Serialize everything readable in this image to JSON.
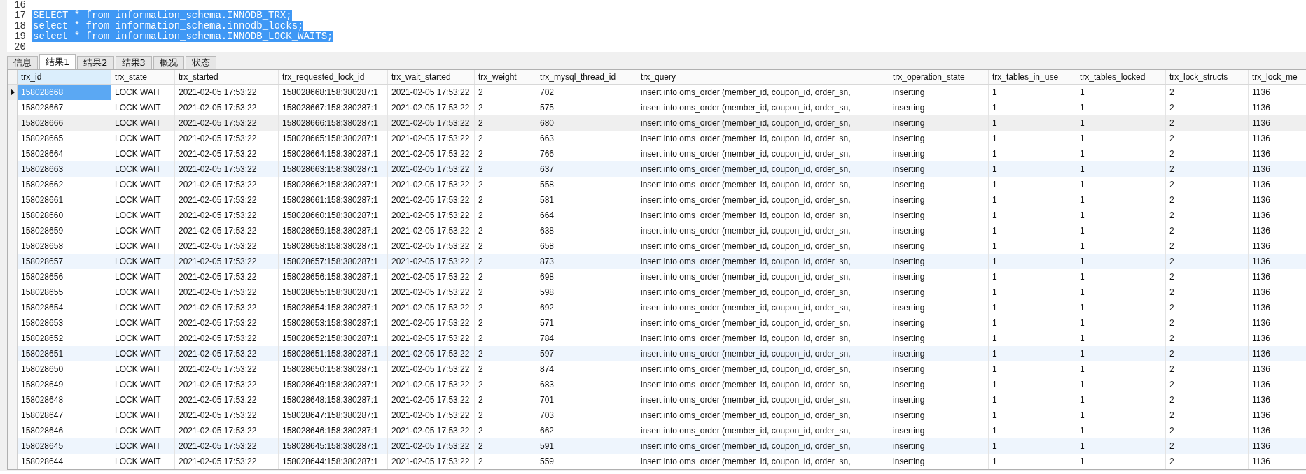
{
  "editor": {
    "lines": [
      {
        "number": "16"
      },
      {
        "number": "17",
        "code": "SELECT * from information_schema.INNODB_TRX;",
        "selected": true
      },
      {
        "number": "18",
        "code": "select * from information_schema.innodb_locks;",
        "selected": true
      },
      {
        "number": "19",
        "code": "select * from information_schema.INNODB_LOCK_WAITS;",
        "selected": true
      },
      {
        "number": "20"
      }
    ]
  },
  "tabs": [
    {
      "label": "信息",
      "selected": false
    },
    {
      "label": "结果1",
      "selected": true
    },
    {
      "label": "结果2",
      "selected": false
    },
    {
      "label": "结果3",
      "selected": false
    },
    {
      "label": "概况",
      "selected": false
    },
    {
      "label": "状态",
      "selected": false
    }
  ],
  "table": {
    "columns": [
      {
        "label": "trx_id",
        "selected": true
      },
      {
        "label": "trx_state",
        "selected": false
      },
      {
        "label": "trx_started",
        "selected": false
      },
      {
        "label": "trx_requested_lock_id",
        "selected": false
      },
      {
        "label": "trx_wait_started",
        "selected": false
      },
      {
        "label": "trx_weight",
        "selected": false
      },
      {
        "label": "trx_mysql_thread_id",
        "selected": false
      },
      {
        "label": "trx_query",
        "selected": false
      },
      {
        "label": "trx_operation_state",
        "selected": false
      },
      {
        "label": "trx_tables_in_use",
        "selected": false
      },
      {
        "label": "trx_tables_locked",
        "selected": false
      },
      {
        "label": "trx_lock_structs",
        "selected": false
      },
      {
        "label": "trx_lock_me",
        "selected": false
      }
    ],
    "rows": [
      {
        "selected": true,
        "kind": "plain",
        "cells": [
          "158028668",
          "LOCK WAIT",
          "2021-02-05 17:53:22",
          "158028668:158:380287:1",
          "2021-02-05 17:53:22",
          "2",
          "702",
          "insert into oms_order (member_id, coupon_id, order_sn,",
          "inserting",
          "1",
          "1",
          "2",
          "1136"
        ]
      },
      {
        "selected": false,
        "kind": "plain",
        "cells": [
          "158028667",
          "LOCK WAIT",
          "2021-02-05 17:53:22",
          "158028667:158:380287:1",
          "2021-02-05 17:53:22",
          "2",
          "575",
          "insert into oms_order (member_id, coupon_id, order_sn,",
          "inserting",
          "1",
          "1",
          "2",
          "1136"
        ]
      },
      {
        "selected": false,
        "kind": "hover",
        "cells": [
          "158028666",
          "LOCK WAIT",
          "2021-02-05 17:53:22",
          "158028666:158:380287:1",
          "2021-02-05 17:53:22",
          "2",
          "680",
          "insert into oms_order (member_id, coupon_id, order_sn,",
          "inserting",
          "1",
          "1",
          "2",
          "1136"
        ]
      },
      {
        "selected": false,
        "kind": "plain",
        "cells": [
          "158028665",
          "LOCK WAIT",
          "2021-02-05 17:53:22",
          "158028665:158:380287:1",
          "2021-02-05 17:53:22",
          "2",
          "663",
          "insert into oms_order (member_id, coupon_id, order_sn,",
          "inserting",
          "1",
          "1",
          "2",
          "1136"
        ]
      },
      {
        "selected": false,
        "kind": "plain",
        "cells": [
          "158028664",
          "LOCK WAIT",
          "2021-02-05 17:53:22",
          "158028664:158:380287:1",
          "2021-02-05 17:53:22",
          "2",
          "766",
          "insert into oms_order (member_id, coupon_id, order_sn,",
          "inserting",
          "1",
          "1",
          "2",
          "1136"
        ]
      },
      {
        "selected": false,
        "kind": "alt",
        "cells": [
          "158028663",
          "LOCK WAIT",
          "2021-02-05 17:53:22",
          "158028663:158:380287:1",
          "2021-02-05 17:53:22",
          "2",
          "637",
          "insert into oms_order (member_id, coupon_id, order_sn,",
          "inserting",
          "1",
          "1",
          "2",
          "1136"
        ]
      },
      {
        "selected": false,
        "kind": "plain",
        "cells": [
          "158028662",
          "LOCK WAIT",
          "2021-02-05 17:53:22",
          "158028662:158:380287:1",
          "2021-02-05 17:53:22",
          "2",
          "558",
          "insert into oms_order (member_id, coupon_id, order_sn,",
          "inserting",
          "1",
          "1",
          "2",
          "1136"
        ]
      },
      {
        "selected": false,
        "kind": "plain",
        "cells": [
          "158028661",
          "LOCK WAIT",
          "2021-02-05 17:53:22",
          "158028661:158:380287:1",
          "2021-02-05 17:53:22",
          "2",
          "581",
          "insert into oms_order (member_id, coupon_id, order_sn,",
          "inserting",
          "1",
          "1",
          "2",
          "1136"
        ]
      },
      {
        "selected": false,
        "kind": "plain",
        "cells": [
          "158028660",
          "LOCK WAIT",
          "2021-02-05 17:53:22",
          "158028660:158:380287:1",
          "2021-02-05 17:53:22",
          "2",
          "664",
          "insert into oms_order (member_id, coupon_id, order_sn,",
          "inserting",
          "1",
          "1",
          "2",
          "1136"
        ]
      },
      {
        "selected": false,
        "kind": "plain",
        "cells": [
          "158028659",
          "LOCK WAIT",
          "2021-02-05 17:53:22",
          "158028659:158:380287:1",
          "2021-02-05 17:53:22",
          "2",
          "638",
          "insert into oms_order (member_id, coupon_id, order_sn,",
          "inserting",
          "1",
          "1",
          "2",
          "1136"
        ]
      },
      {
        "selected": false,
        "kind": "plain",
        "cells": [
          "158028658",
          "LOCK WAIT",
          "2021-02-05 17:53:22",
          "158028658:158:380287:1",
          "2021-02-05 17:53:22",
          "2",
          "658",
          "insert into oms_order (member_id, coupon_id, order_sn,",
          "inserting",
          "1",
          "1",
          "2",
          "1136"
        ]
      },
      {
        "selected": false,
        "kind": "alt",
        "cells": [
          "158028657",
          "LOCK WAIT",
          "2021-02-05 17:53:22",
          "158028657:158:380287:1",
          "2021-02-05 17:53:22",
          "2",
          "873",
          "insert into oms_order (member_id, coupon_id, order_sn,",
          "inserting",
          "1",
          "1",
          "2",
          "1136"
        ]
      },
      {
        "selected": false,
        "kind": "plain",
        "cells": [
          "158028656",
          "LOCK WAIT",
          "2021-02-05 17:53:22",
          "158028656:158:380287:1",
          "2021-02-05 17:53:22",
          "2",
          "698",
          "insert into oms_order (member_id, coupon_id, order_sn,",
          "inserting",
          "1",
          "1",
          "2",
          "1136"
        ]
      },
      {
        "selected": false,
        "kind": "plain",
        "cells": [
          "158028655",
          "LOCK WAIT",
          "2021-02-05 17:53:22",
          "158028655:158:380287:1",
          "2021-02-05 17:53:22",
          "2",
          "598",
          "insert into oms_order (member_id, coupon_id, order_sn,",
          "inserting",
          "1",
          "1",
          "2",
          "1136"
        ]
      },
      {
        "selected": false,
        "kind": "plain",
        "cells": [
          "158028654",
          "LOCK WAIT",
          "2021-02-05 17:53:22",
          "158028654:158:380287:1",
          "2021-02-05 17:53:22",
          "2",
          "692",
          "insert into oms_order (member_id, coupon_id, order_sn,",
          "inserting",
          "1",
          "1",
          "2",
          "1136"
        ]
      },
      {
        "selected": false,
        "kind": "plain",
        "cells": [
          "158028653",
          "LOCK WAIT",
          "2021-02-05 17:53:22",
          "158028653:158:380287:1",
          "2021-02-05 17:53:22",
          "2",
          "571",
          "insert into oms_order (member_id, coupon_id, order_sn,",
          "inserting",
          "1",
          "1",
          "2",
          "1136"
        ]
      },
      {
        "selected": false,
        "kind": "plain",
        "cells": [
          "158028652",
          "LOCK WAIT",
          "2021-02-05 17:53:22",
          "158028652:158:380287:1",
          "2021-02-05 17:53:22",
          "2",
          "784",
          "insert into oms_order (member_id, coupon_id, order_sn,",
          "inserting",
          "1",
          "1",
          "2",
          "1136"
        ]
      },
      {
        "selected": false,
        "kind": "alt",
        "cells": [
          "158028651",
          "LOCK WAIT",
          "2021-02-05 17:53:22",
          "158028651:158:380287:1",
          "2021-02-05 17:53:22",
          "2",
          "597",
          "insert into oms_order (member_id, coupon_id, order_sn,",
          "inserting",
          "1",
          "1",
          "2",
          "1136"
        ]
      },
      {
        "selected": false,
        "kind": "plain",
        "cells": [
          "158028650",
          "LOCK WAIT",
          "2021-02-05 17:53:22",
          "158028650:158:380287:1",
          "2021-02-05 17:53:22",
          "2",
          "874",
          "insert into oms_order (member_id, coupon_id, order_sn,",
          "inserting",
          "1",
          "1",
          "2",
          "1136"
        ]
      },
      {
        "selected": false,
        "kind": "plain",
        "cells": [
          "158028649",
          "LOCK WAIT",
          "2021-02-05 17:53:22",
          "158028649:158:380287:1",
          "2021-02-05 17:53:22",
          "2",
          "683",
          "insert into oms_order (member_id, coupon_id, order_sn,",
          "inserting",
          "1",
          "1",
          "2",
          "1136"
        ]
      },
      {
        "selected": false,
        "kind": "plain",
        "cells": [
          "158028648",
          "LOCK WAIT",
          "2021-02-05 17:53:22",
          "158028648:158:380287:1",
          "2021-02-05 17:53:22",
          "2",
          "701",
          "insert into oms_order (member_id, coupon_id, order_sn,",
          "inserting",
          "1",
          "1",
          "2",
          "1136"
        ]
      },
      {
        "selected": false,
        "kind": "plain",
        "cells": [
          "158028647",
          "LOCK WAIT",
          "2021-02-05 17:53:22",
          "158028647:158:380287:1",
          "2021-02-05 17:53:22",
          "2",
          "703",
          "insert into oms_order (member_id, coupon_id, order_sn,",
          "inserting",
          "1",
          "1",
          "2",
          "1136"
        ]
      },
      {
        "selected": false,
        "kind": "plain",
        "cells": [
          "158028646",
          "LOCK WAIT",
          "2021-02-05 17:53:22",
          "158028646:158:380287:1",
          "2021-02-05 17:53:22",
          "2",
          "662",
          "insert into oms_order (member_id, coupon_id, order_sn,",
          "inserting",
          "1",
          "1",
          "2",
          "1136"
        ]
      },
      {
        "selected": false,
        "kind": "alt",
        "cells": [
          "158028645",
          "LOCK WAIT",
          "2021-02-05 17:53:22",
          "158028645:158:380287:1",
          "2021-02-05 17:53:22",
          "2",
          "591",
          "insert into oms_order (member_id, coupon_id, order_sn,",
          "inserting",
          "1",
          "1",
          "2",
          "1136"
        ]
      },
      {
        "selected": false,
        "kind": "plain",
        "cells": [
          "158028644",
          "LOCK WAIT",
          "2021-02-05 17:53:22",
          "158028644:158:380287:1",
          "2021-02-05 17:53:22",
          "2",
          "559",
          "insert into oms_order (member_id, coupon_id, order_sn,",
          "inserting",
          "1",
          "1",
          "2",
          "1136"
        ]
      }
    ]
  }
}
